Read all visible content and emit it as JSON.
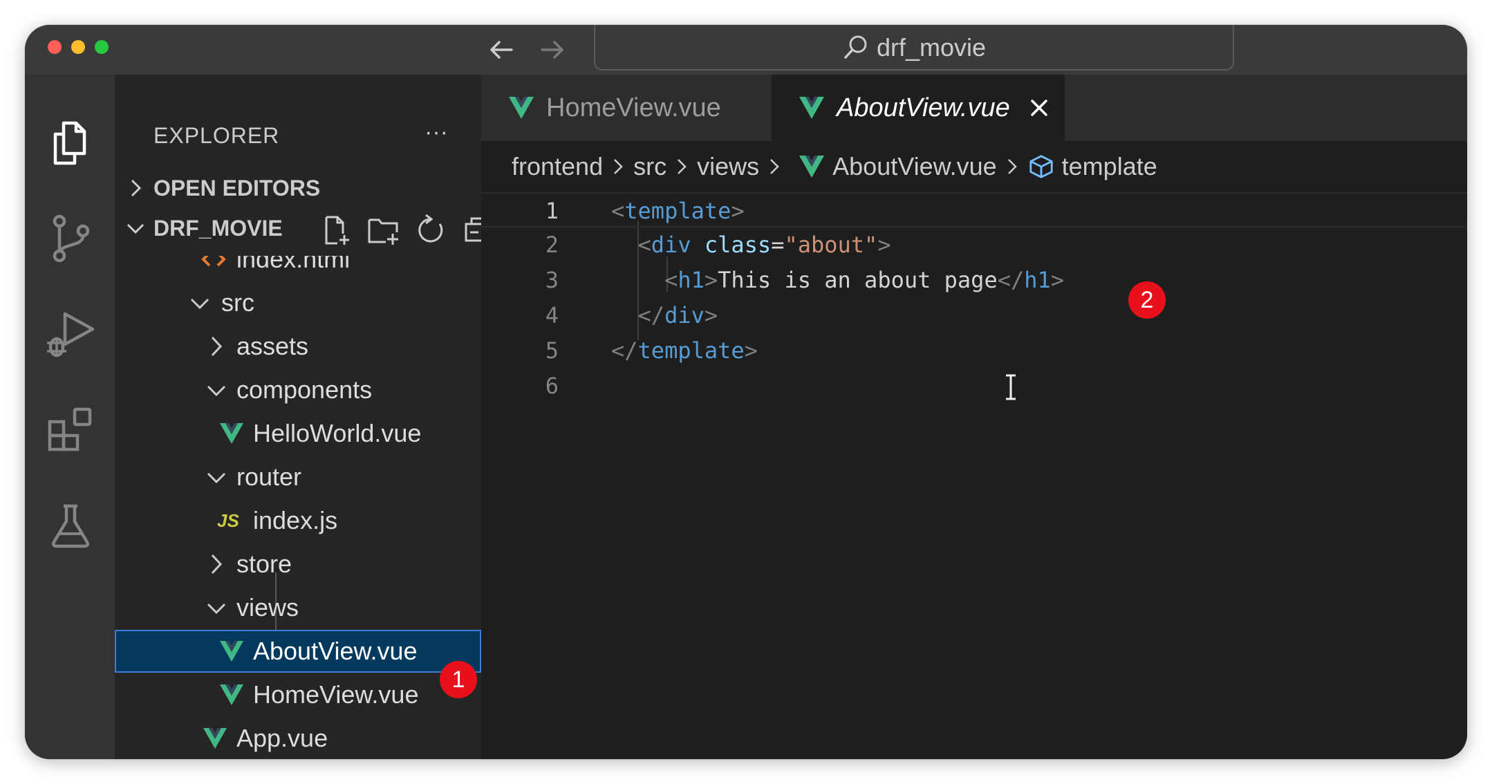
{
  "titlebar": {
    "search_text": "drf_movie"
  },
  "sidebar": {
    "title": "EXPLORER",
    "more_label": "···",
    "open_editors_label": "OPEN EDITORS",
    "project_label": "DRF_MOVIE",
    "tree": [
      {
        "name": "index.html",
        "type": "html"
      },
      {
        "name": "src",
        "type": "folder-open"
      },
      {
        "name": "assets",
        "type": "folder-closed"
      },
      {
        "name": "components",
        "type": "folder-open"
      },
      {
        "name": "HelloWorld.vue",
        "type": "vue"
      },
      {
        "name": "router",
        "type": "folder-open"
      },
      {
        "name": "index.js",
        "type": "js"
      },
      {
        "name": "store",
        "type": "folder-closed"
      },
      {
        "name": "views",
        "type": "folder-open"
      },
      {
        "name": "AboutView.vue",
        "type": "vue",
        "selected": true
      },
      {
        "name": "HomeView.vue",
        "type": "vue"
      },
      {
        "name": "App.vue",
        "type": "vue"
      }
    ],
    "js_icon_label": "JS"
  },
  "tabs": [
    {
      "label": "HomeView.vue",
      "active": false
    },
    {
      "label": "AboutView.vue",
      "active": true
    }
  ],
  "breadcrumb": [
    "frontend",
    "src",
    "views",
    "AboutView.vue",
    "template"
  ],
  "editor": {
    "line_numbers": [
      "1",
      "2",
      "3",
      "4",
      "5",
      "6"
    ],
    "lines": [
      [
        {
          "t": "<",
          "c": "tag"
        },
        {
          "t": "template",
          "c": "name"
        },
        {
          "t": ">",
          "c": "tag"
        }
      ],
      [
        {
          "t": "  ",
          "c": "txt"
        },
        {
          "t": "<",
          "c": "tag"
        },
        {
          "t": "div",
          "c": "name"
        },
        {
          "t": " ",
          "c": "txt"
        },
        {
          "t": "class",
          "c": "attr"
        },
        {
          "t": "=",
          "c": "txt"
        },
        {
          "t": "\"about\"",
          "c": "str"
        },
        {
          "t": ">",
          "c": "tag"
        }
      ],
      [
        {
          "t": "    ",
          "c": "txt"
        },
        {
          "t": "<",
          "c": "tag"
        },
        {
          "t": "h1",
          "c": "name"
        },
        {
          "t": ">",
          "c": "tag"
        },
        {
          "t": "This is an about page",
          "c": "txt"
        },
        {
          "t": "</",
          "c": "tag"
        },
        {
          "t": "h1",
          "c": "name"
        },
        {
          "t": ">",
          "c": "tag"
        }
      ],
      [
        {
          "t": "  ",
          "c": "txt"
        },
        {
          "t": "</",
          "c": "tag"
        },
        {
          "t": "div",
          "c": "name"
        },
        {
          "t": ">",
          "c": "tag"
        }
      ],
      [
        {
          "t": "</",
          "c": "tag"
        },
        {
          "t": "template",
          "c": "name"
        },
        {
          "t": ">",
          "c": "tag"
        }
      ],
      []
    ]
  },
  "annotations": {
    "badge_1": "1",
    "badge_2": "2"
  },
  "icons": {
    "activity": [
      "explorer-icon",
      "source-control-icon",
      "run-debug-icon",
      "extensions-icon",
      "testing-icon"
    ],
    "project_actions": [
      "new-file-icon",
      "new-folder-icon",
      "refresh-icon",
      "collapse-all-icon"
    ]
  },
  "colors": {
    "vue_green": "#41b883",
    "badge_red": "#e8101a",
    "selection": "#04395e",
    "tag_blue": "#569cd6",
    "string": "#ce9178"
  }
}
